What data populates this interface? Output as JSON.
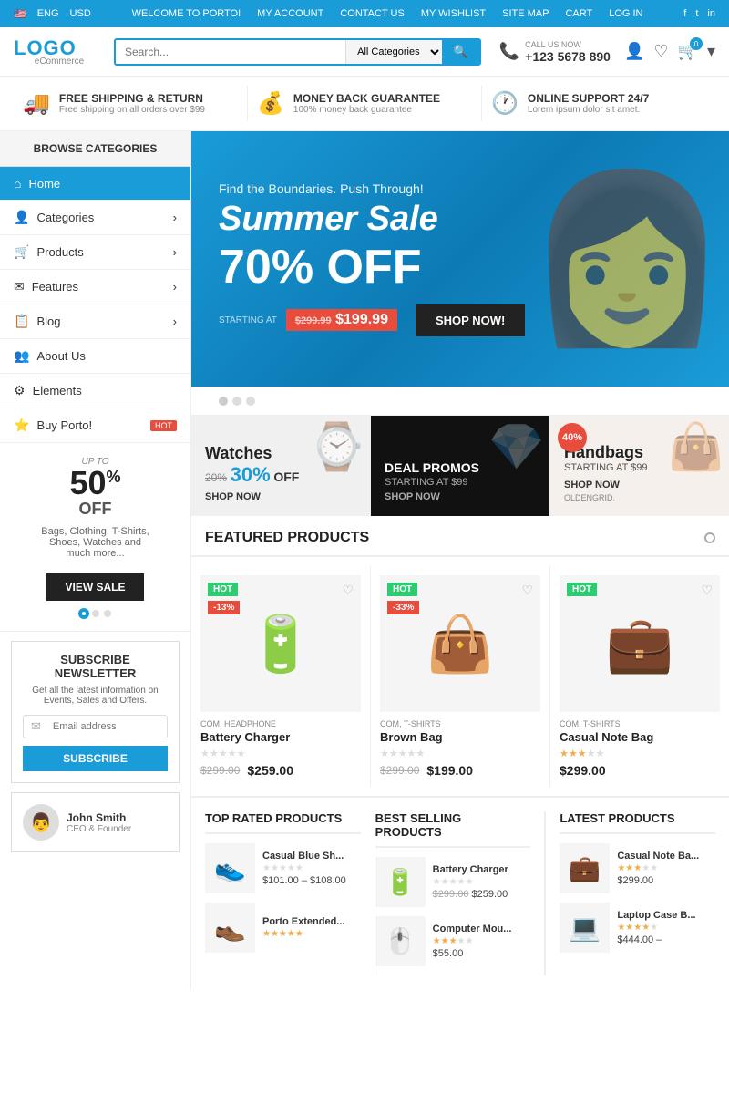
{
  "topbar": {
    "lang": "ENG",
    "currency": "USD",
    "welcome": "WELCOME TO PORTO!",
    "my_account": "MY ACCOUNT",
    "contact_us": "CONTACT US",
    "my_wishlist": "MY WISHLIST",
    "site_map": "SITE MAP",
    "cart": "CART",
    "log_in": "LOG IN"
  },
  "header": {
    "logo_text": "LOGO",
    "logo_sub": "eCommerce",
    "search_placeholder": "Search...",
    "search_category": "All Categories",
    "phone_label": "CALL US NOW",
    "phone_number": "+123 5678 890",
    "cart_count": "0"
  },
  "shipping": [
    {
      "icon": "🚚",
      "title": "FREE SHIPPING & RETURN",
      "sub": "Free shipping on all orders over $99"
    },
    {
      "icon": "💰",
      "title": "MONEY BACK GUARANTEE",
      "sub": "100% money back guarantee"
    },
    {
      "icon": "🕐",
      "title": "ONLINE SUPPORT 24/7",
      "sub": "Lorem ipsum dolor sit amet."
    }
  ],
  "sidebar": {
    "browse_title": "BROWSE CATEGORIES",
    "items": [
      {
        "label": "Home",
        "icon": "⌂",
        "active": true
      },
      {
        "label": "Categories",
        "icon": "👤",
        "arrow": true
      },
      {
        "label": "Products",
        "icon": "🛒",
        "arrow": true
      },
      {
        "label": "Features",
        "icon": "✉",
        "arrow": true
      },
      {
        "label": "Blog",
        "icon": "📋",
        "arrow": true
      },
      {
        "label": "About Us",
        "icon": "👥"
      },
      {
        "label": "Elements",
        "icon": "⚙"
      },
      {
        "label": "Buy Porto!",
        "icon": "⭐",
        "hot": true
      }
    ]
  },
  "promo_widget": {
    "pre": "UP TO",
    "big": "50",
    "sup": "%",
    "off": "OFF",
    "desc": "Bags, Clothing, T-Shirts,\nShoes, Watches and\nmuch more...",
    "btn": "VIEW SALE"
  },
  "newsletter": {
    "title": "SUBSCRIBE NEWSLETTER",
    "desc": "Get all the latest information on Events, Sales and Offers.",
    "placeholder": "Email address",
    "btn": "SUBSCRIBE"
  },
  "testimonial": {
    "name": "John Smith",
    "role": "CEO & Founder"
  },
  "hero": {
    "sub": "Find the Boundaries. Push Through!",
    "title": "Summer Sale",
    "discount": "70% OFF",
    "starting_label": "STARTING AT",
    "old_price": "$299.99",
    "price": "$199.99",
    "btn": "SHOP NOW!"
  },
  "promo_cards": [
    {
      "title": "Watches",
      "old_pct": "20%",
      "new_pct": "30%",
      "suffix": "OFF",
      "shop": "SHOP NOW",
      "icon": "⌚",
      "type": "watches"
    },
    {
      "title": "DEAL PROMOS",
      "sub": "STARTING AT $99",
      "shop": "SHOP NOW",
      "icon": "💎",
      "type": "deal"
    },
    {
      "title": "Handbags",
      "badge": "40%",
      "sub": "STARTING AT $99",
      "shop": "SHOP NOW",
      "icon": "👜",
      "type": "handbags"
    }
  ],
  "featured": {
    "title": "FEATURED PRODUCTS",
    "products": [
      {
        "category": "COM, HEADPHONE",
        "name": "Battery Charger",
        "hot": true,
        "discount": "-13%",
        "old_price": "$299.00",
        "price": "$259.00",
        "stars": 0,
        "icon": "🔋"
      },
      {
        "category": "COM, T-SHIRTS",
        "name": "Brown Bag",
        "hot": true,
        "discount": "-33%",
        "old_price": "$299.00",
        "price": "$199.00",
        "stars": 0,
        "icon": "👜"
      },
      {
        "category": "COM, T-SHIRTS",
        "name": "Casual Note Bag",
        "hot": true,
        "discount": null,
        "old_price": null,
        "price": "$299.00",
        "stars": 3.5,
        "icon": "💼"
      }
    ]
  },
  "bottom_sections": {
    "top_rated": {
      "title": "TOP RATED PRODUCTS",
      "products": [
        {
          "name": "Casual Blue Sh...",
          "price_from": "$101.00",
          "price_to": "$108.00",
          "stars": 0,
          "icon": "👟"
        },
        {
          "name": "Porto Extended...",
          "stars": 5,
          "icon": "👞"
        }
      ]
    },
    "best_selling": {
      "title": "BEST SELLING PRODUCTS",
      "products": [
        {
          "name": "Battery Charger",
          "old_price": "$299.00",
          "price": "$259.00",
          "stars": 0,
          "icon": "🔋"
        },
        {
          "name": "Computer Mou...",
          "price": "$55.00",
          "stars": 3,
          "icon": "🖱️"
        }
      ]
    },
    "latest": {
      "title": "LATEST PRODUCTS",
      "products": [
        {
          "name": "Casual Note Ba...",
          "price": "$299.00",
          "stars": 3.5,
          "icon": "💼"
        },
        {
          "name": "Laptop Case B...",
          "price_from": "$444.00",
          "stars": 4,
          "icon": "💻"
        }
      ]
    }
  }
}
